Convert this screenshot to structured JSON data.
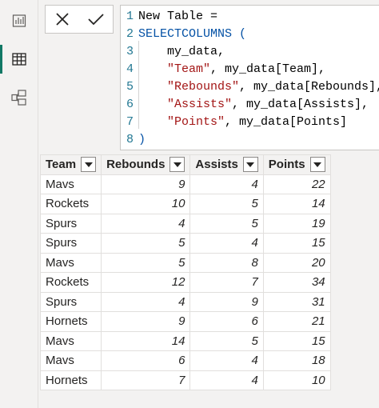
{
  "rail": {
    "items": [
      {
        "name": "report-view-icon",
        "active": false
      },
      {
        "name": "data-view-icon",
        "active": true
      },
      {
        "name": "model-view-icon",
        "active": false
      }
    ]
  },
  "formula_bar": {
    "lines": [
      {
        "n": "1",
        "parts": [
          {
            "t": "New Table ="
          }
        ]
      },
      {
        "n": "2",
        "parts": [
          {
            "t": "SELECTCOLUMNS (",
            "c": "kw"
          }
        ]
      },
      {
        "n": "3",
        "parts": [
          {
            "t": "    my_data,"
          }
        ]
      },
      {
        "n": "4",
        "parts": [
          {
            "t": "    "
          },
          {
            "t": "\"Team\"",
            "c": "str"
          },
          {
            "t": ", my_data[Team],"
          }
        ]
      },
      {
        "n": "5",
        "parts": [
          {
            "t": "    "
          },
          {
            "t": "\"Rebounds\"",
            "c": "str"
          },
          {
            "t": ", my_data[Rebounds],"
          }
        ]
      },
      {
        "n": "6",
        "parts": [
          {
            "t": "    "
          },
          {
            "t": "\"Assists\"",
            "c": "str"
          },
          {
            "t": ", my_data[Assists],"
          }
        ]
      },
      {
        "n": "7",
        "parts": [
          {
            "t": "    "
          },
          {
            "t": "\"Points\"",
            "c": "str"
          },
          {
            "t": ", my_data[Points]"
          }
        ]
      },
      {
        "n": "8",
        "parts": [
          {
            "t": ")",
            "c": "kw"
          }
        ]
      }
    ]
  },
  "table": {
    "columns": [
      "Team",
      "Rebounds",
      "Assists",
      "Points"
    ],
    "rows": [
      [
        "Mavs",
        "9",
        "4",
        "22"
      ],
      [
        "Rockets",
        "10",
        "5",
        "14"
      ],
      [
        "Spurs",
        "4",
        "5",
        "19"
      ],
      [
        "Spurs",
        "5",
        "4",
        "15"
      ],
      [
        "Mavs",
        "5",
        "8",
        "20"
      ],
      [
        "Rockets",
        "12",
        "7",
        "34"
      ],
      [
        "Spurs",
        "4",
        "9",
        "31"
      ],
      [
        "Hornets",
        "9",
        "6",
        "21"
      ],
      [
        "Mavs",
        "14",
        "5",
        "15"
      ],
      [
        "Mavs",
        "6",
        "4",
        "18"
      ],
      [
        "Hornets",
        "7",
        "4",
        "10"
      ]
    ]
  },
  "colors": {
    "accent": "#117865",
    "keyword": "#0451a5",
    "string": "#a31515",
    "line_number": "#237893"
  }
}
